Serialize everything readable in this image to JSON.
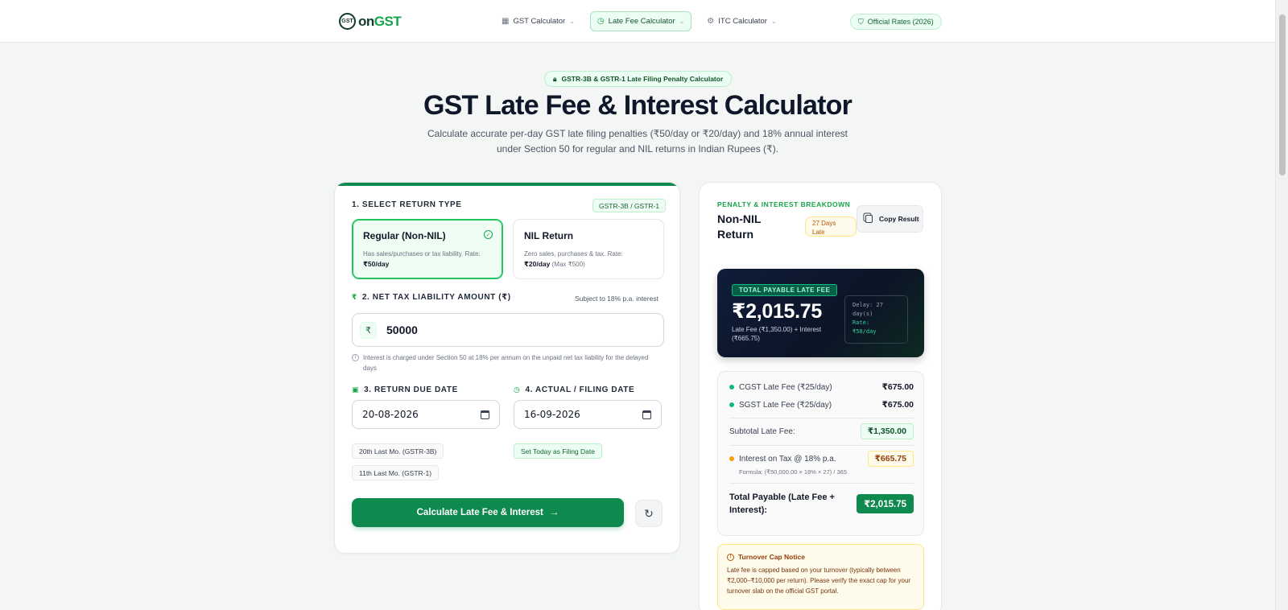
{
  "nav": {
    "logo_prefix": "GST",
    "logo_on": "on",
    "logo_main": "GST",
    "items": [
      {
        "label": "GST Calculator",
        "icon": "calculator-icon"
      },
      {
        "label": "Late Fee Calculator",
        "icon": "clock-icon"
      },
      {
        "label": "ITC Calculator",
        "icon": "gear-icon"
      }
    ],
    "official_rates": "Official Rates (2026)"
  },
  "hero": {
    "pill": "GSTR-3B & GSTR-1 Late Filing Penalty Calculator",
    "title": "GST Late Fee & Interest Calculator",
    "subtitle": "Calculate accurate per-day GST late filing penalties (₹50/day or ₹20/day) and 18% annual interest under Section 50 for regular and NIL returns in Indian Rupees (₹)."
  },
  "form": {
    "step1_label": "1. SELECT RETURN TYPE",
    "step1_tag": "GSTR-3B / GSTR-1",
    "options": [
      {
        "title": "Regular (Non-NIL)",
        "desc": "Has sales/purchases or tax liability. Rate:",
        "rate": "₹50/day",
        "extra": "",
        "selected": true
      },
      {
        "title": "NIL Return",
        "desc": "Zero sales, purchases & tax. Rate:",
        "rate": "₹20/day",
        "extra": "(Max ₹500)",
        "selected": false
      }
    ],
    "step2_label": "2. NET TAX LIABILITY AMOUNT (₹)",
    "step2_note": "Subject to 18% p.a. interest",
    "currency_symbol": "₹",
    "amount_value": "50000",
    "interest_note": "Interest is charged under Section 50 at 18% per annum on the unpaid net tax liability for the delayed days",
    "step3_label": "3. RETURN DUE DATE",
    "due_date": "20-08-2026",
    "step4_label": "4. ACTUAL / FILING DATE",
    "filing_date": "16-09-2026",
    "chip_3b": "20th Last Mo. (GSTR-3B)",
    "chip_1": "11th Last Mo. (GSTR-1)",
    "chip_today": "Set Today as Filing Date",
    "calc_button": "Calculate Late Fee & Interest",
    "calc_arrow": "→",
    "reset_icon": "↻"
  },
  "result": {
    "section_label": "PENALTY & INTEREST BREAKDOWN",
    "return_title": "Non-NIL Return",
    "late_badge": "27 Days Late",
    "copy_label": "Copy Result",
    "total_badge": "TOTAL PAYABLE LATE FEE",
    "total_amount": "₹2,015.75",
    "total_sub": "Late Fee (₹1,350.00) + Interest (₹665.75)",
    "delay_line1": "Delay: 27",
    "delay_line2": "day(s)",
    "delay_rate_label": "Rate:",
    "delay_rate": "₹50/day",
    "cgst_label": "CGST Late Fee (₹25/day)",
    "cgst_amount": "₹675.00",
    "sgst_label": "SGST Late Fee (₹25/day)",
    "sgst_amount": "₹675.00",
    "subtotal_label": "Subtotal Late Fee:",
    "subtotal_amount": "₹1,350.00",
    "interest_label": "Interest on Tax @ 18% p.a.",
    "interest_amount": "₹665.75",
    "formula": "Formula: (₹50,000.00 × 18% × 27) / 365",
    "total_label": "Total Payable (Late Fee + Interest):",
    "total_payable": "₹2,015.75",
    "notice_title": "Turnover Cap Notice",
    "notice_body": "Late fee is capped based on your turnover (typically between ₹2,000–₹10,000 per return). Please verify the exact cap for your turnover slab on the official GST portal."
  },
  "colors": {
    "brand_green": "#0f8a4f",
    "accent_green": "#16a34a",
    "dark_card": "#0f1d3a",
    "amber": "#fde68a"
  }
}
